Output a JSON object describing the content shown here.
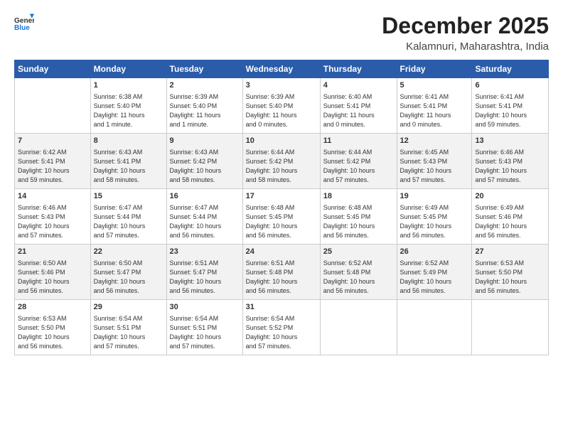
{
  "header": {
    "logo_line1": "General",
    "logo_line2": "Blue",
    "month": "December 2025",
    "location": "Kalamnuri, Maharashtra, India"
  },
  "days_of_week": [
    "Sunday",
    "Monday",
    "Tuesday",
    "Wednesday",
    "Thursday",
    "Friday",
    "Saturday"
  ],
  "weeks": [
    [
      {
        "day": "",
        "info": ""
      },
      {
        "day": "1",
        "info": "Sunrise: 6:38 AM\nSunset: 5:40 PM\nDaylight: 11 hours\nand 1 minute."
      },
      {
        "day": "2",
        "info": "Sunrise: 6:39 AM\nSunset: 5:40 PM\nDaylight: 11 hours\nand 1 minute."
      },
      {
        "day": "3",
        "info": "Sunrise: 6:39 AM\nSunset: 5:40 PM\nDaylight: 11 hours\nand 0 minutes."
      },
      {
        "day": "4",
        "info": "Sunrise: 6:40 AM\nSunset: 5:41 PM\nDaylight: 11 hours\nand 0 minutes."
      },
      {
        "day": "5",
        "info": "Sunrise: 6:41 AM\nSunset: 5:41 PM\nDaylight: 11 hours\nand 0 minutes."
      },
      {
        "day": "6",
        "info": "Sunrise: 6:41 AM\nSunset: 5:41 PM\nDaylight: 10 hours\nand 59 minutes."
      }
    ],
    [
      {
        "day": "7",
        "info": "Sunrise: 6:42 AM\nSunset: 5:41 PM\nDaylight: 10 hours\nand 59 minutes."
      },
      {
        "day": "8",
        "info": "Sunrise: 6:43 AM\nSunset: 5:41 PM\nDaylight: 10 hours\nand 58 minutes."
      },
      {
        "day": "9",
        "info": "Sunrise: 6:43 AM\nSunset: 5:42 PM\nDaylight: 10 hours\nand 58 minutes."
      },
      {
        "day": "10",
        "info": "Sunrise: 6:44 AM\nSunset: 5:42 PM\nDaylight: 10 hours\nand 58 minutes."
      },
      {
        "day": "11",
        "info": "Sunrise: 6:44 AM\nSunset: 5:42 PM\nDaylight: 10 hours\nand 57 minutes."
      },
      {
        "day": "12",
        "info": "Sunrise: 6:45 AM\nSunset: 5:43 PM\nDaylight: 10 hours\nand 57 minutes."
      },
      {
        "day": "13",
        "info": "Sunrise: 6:46 AM\nSunset: 5:43 PM\nDaylight: 10 hours\nand 57 minutes."
      }
    ],
    [
      {
        "day": "14",
        "info": "Sunrise: 6:46 AM\nSunset: 5:43 PM\nDaylight: 10 hours\nand 57 minutes."
      },
      {
        "day": "15",
        "info": "Sunrise: 6:47 AM\nSunset: 5:44 PM\nDaylight: 10 hours\nand 57 minutes."
      },
      {
        "day": "16",
        "info": "Sunrise: 6:47 AM\nSunset: 5:44 PM\nDaylight: 10 hours\nand 56 minutes."
      },
      {
        "day": "17",
        "info": "Sunrise: 6:48 AM\nSunset: 5:45 PM\nDaylight: 10 hours\nand 56 minutes."
      },
      {
        "day": "18",
        "info": "Sunrise: 6:48 AM\nSunset: 5:45 PM\nDaylight: 10 hours\nand 56 minutes."
      },
      {
        "day": "19",
        "info": "Sunrise: 6:49 AM\nSunset: 5:45 PM\nDaylight: 10 hours\nand 56 minutes."
      },
      {
        "day": "20",
        "info": "Sunrise: 6:49 AM\nSunset: 5:46 PM\nDaylight: 10 hours\nand 56 minutes."
      }
    ],
    [
      {
        "day": "21",
        "info": "Sunrise: 6:50 AM\nSunset: 5:46 PM\nDaylight: 10 hours\nand 56 minutes."
      },
      {
        "day": "22",
        "info": "Sunrise: 6:50 AM\nSunset: 5:47 PM\nDaylight: 10 hours\nand 56 minutes."
      },
      {
        "day": "23",
        "info": "Sunrise: 6:51 AM\nSunset: 5:47 PM\nDaylight: 10 hours\nand 56 minutes."
      },
      {
        "day": "24",
        "info": "Sunrise: 6:51 AM\nSunset: 5:48 PM\nDaylight: 10 hours\nand 56 minutes."
      },
      {
        "day": "25",
        "info": "Sunrise: 6:52 AM\nSunset: 5:48 PM\nDaylight: 10 hours\nand 56 minutes."
      },
      {
        "day": "26",
        "info": "Sunrise: 6:52 AM\nSunset: 5:49 PM\nDaylight: 10 hours\nand 56 minutes."
      },
      {
        "day": "27",
        "info": "Sunrise: 6:53 AM\nSunset: 5:50 PM\nDaylight: 10 hours\nand 56 minutes."
      }
    ],
    [
      {
        "day": "28",
        "info": "Sunrise: 6:53 AM\nSunset: 5:50 PM\nDaylight: 10 hours\nand 56 minutes."
      },
      {
        "day": "29",
        "info": "Sunrise: 6:54 AM\nSunset: 5:51 PM\nDaylight: 10 hours\nand 57 minutes."
      },
      {
        "day": "30",
        "info": "Sunrise: 6:54 AM\nSunset: 5:51 PM\nDaylight: 10 hours\nand 57 minutes."
      },
      {
        "day": "31",
        "info": "Sunrise: 6:54 AM\nSunset: 5:52 PM\nDaylight: 10 hours\nand 57 minutes."
      },
      {
        "day": "",
        "info": ""
      },
      {
        "day": "",
        "info": ""
      },
      {
        "day": "",
        "info": ""
      }
    ]
  ]
}
